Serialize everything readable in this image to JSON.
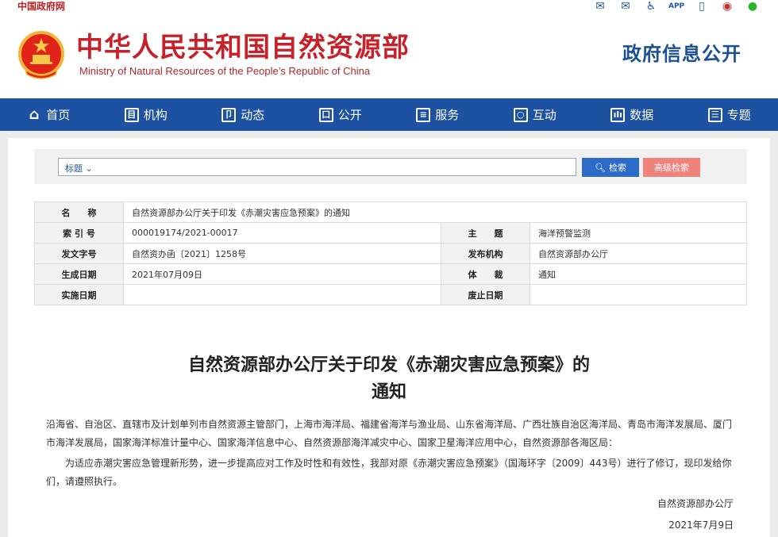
{
  "topbar": {
    "gov_link": "中国政府网",
    "icons": [
      "mail-icon",
      "mail-edit-icon",
      "accessibility-icon",
      "app-icon",
      "mobile-icon",
      "weibo-icon",
      "wechat-icon"
    ],
    "app_label": "APP"
  },
  "header": {
    "title": "中华人民共和国自然资源部",
    "title_en": "Ministry of Natural Resources of the People’s Republic of China",
    "gov_info": "政府信息公开"
  },
  "nav": {
    "items": [
      {
        "label": "首页",
        "icon": "home-icon",
        "glyph": "⌂"
      },
      {
        "label": "机构",
        "icon": "org-icon",
        "glyph": "目"
      },
      {
        "label": "动态",
        "icon": "book-icon",
        "glyph": "卩"
      },
      {
        "label": "公开",
        "icon": "monitor-icon",
        "glyph": "口"
      },
      {
        "label": "服务",
        "icon": "document-icon",
        "glyph": "≡"
      },
      {
        "label": "互动",
        "icon": "chat-icon",
        "glyph": "○"
      },
      {
        "label": "数据",
        "icon": "chart-icon",
        "glyph": "ılı"
      },
      {
        "label": "专题",
        "icon": "list-icon",
        "glyph": "☰"
      }
    ]
  },
  "search": {
    "type_label": "标题",
    "placeholder": "",
    "search_label": "检索",
    "advanced_label": "高级检索"
  },
  "meta": {
    "name_label": "名　　称",
    "name_value": "自然资源部办公厅关于印发《赤潮灾害应急预案》的通知",
    "index_label": "索 引 号",
    "index_value": "000019174/2021-00017",
    "topic_label": "主　　题",
    "topic_value": "海洋预警监测",
    "docno_label": "发文字号",
    "docno_value": "自然资办函〔2021〕1258号",
    "issuer_label": "发布机构",
    "issuer_value": "自然资源部办公厅",
    "date_label": "生成日期",
    "date_value": "2021年07月09日",
    "genre_label": "体　　裁",
    "genre_value": "通知",
    "effective_label": "实施日期",
    "effective_value": "",
    "abolish_label": "废止日期",
    "abolish_value": ""
  },
  "document": {
    "title_line1": "自然资源部办公厅关于印发《赤潮灾害应急预案》的",
    "title_line2": "通知",
    "para1": "沿海省、自治区、直辖市及计划单列市自然资源主管部门，上海市海洋局、福建省海洋与渔业局、山东省海洋局、广西壮族自治区海洋局、青岛市海洋发展局、厦门市海洋发展局，国家海洋标准计量中心、国家海洋信息中心、自然资源部海洋减灾中心、国家卫星海洋应用中心，自然资源部各海区局：",
    "para2": "为适应赤潮灾害应急管理新形势，进一步提高应对工作及时性和有效性，我部对原《赤潮灾害应急预案》（国海环字〔2009〕443号）进行了修订，现印发给你们，请遵照执行。",
    "sign_org": "自然资源部办公厅",
    "sign_date": "2021年7月9日"
  },
  "colors": {
    "brand_red": "#c7222a",
    "nav_blue": "#1c52a1",
    "search_blue": "#2c6cc8",
    "advanced_salmon": "#f0847c"
  }
}
